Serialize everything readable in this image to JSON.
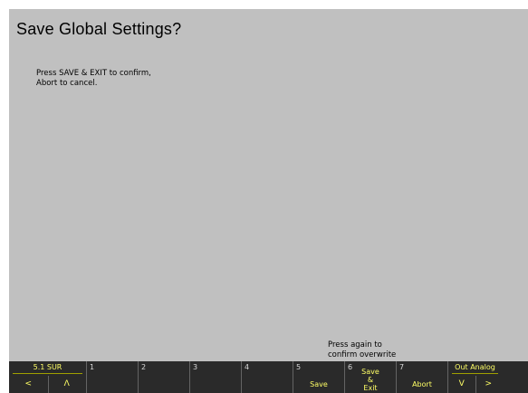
{
  "dialog": {
    "title": "Save Global Settings?",
    "message_line1": "Press SAVE & EXIT to confirm,",
    "message_line2": "Abort to cancel.",
    "hint_line1": "Press again to",
    "hint_line2": "confirm overwrite"
  },
  "softkeys": {
    "mode": {
      "label": "5.1 SUR",
      "left": "<",
      "right": "Λ"
    },
    "k1": {
      "num": "1",
      "label": ""
    },
    "k2": {
      "num": "2",
      "label": ""
    },
    "k3": {
      "num": "3",
      "label": ""
    },
    "k4": {
      "num": "4",
      "label": ""
    },
    "k5": {
      "num": "5",
      "label": "Save"
    },
    "k6": {
      "num": "6",
      "line1": "Save",
      "line2": "&",
      "line3": "Exit"
    },
    "k7": {
      "num": "7",
      "label": "Abort"
    },
    "output": {
      "label": "Out Analog",
      "left": "V",
      "right": ">"
    }
  },
  "colors": {
    "screen_bg": "#c0c0c0",
    "softkey_bg": "#2a2a2a",
    "softkey_text": "#ffff66"
  }
}
